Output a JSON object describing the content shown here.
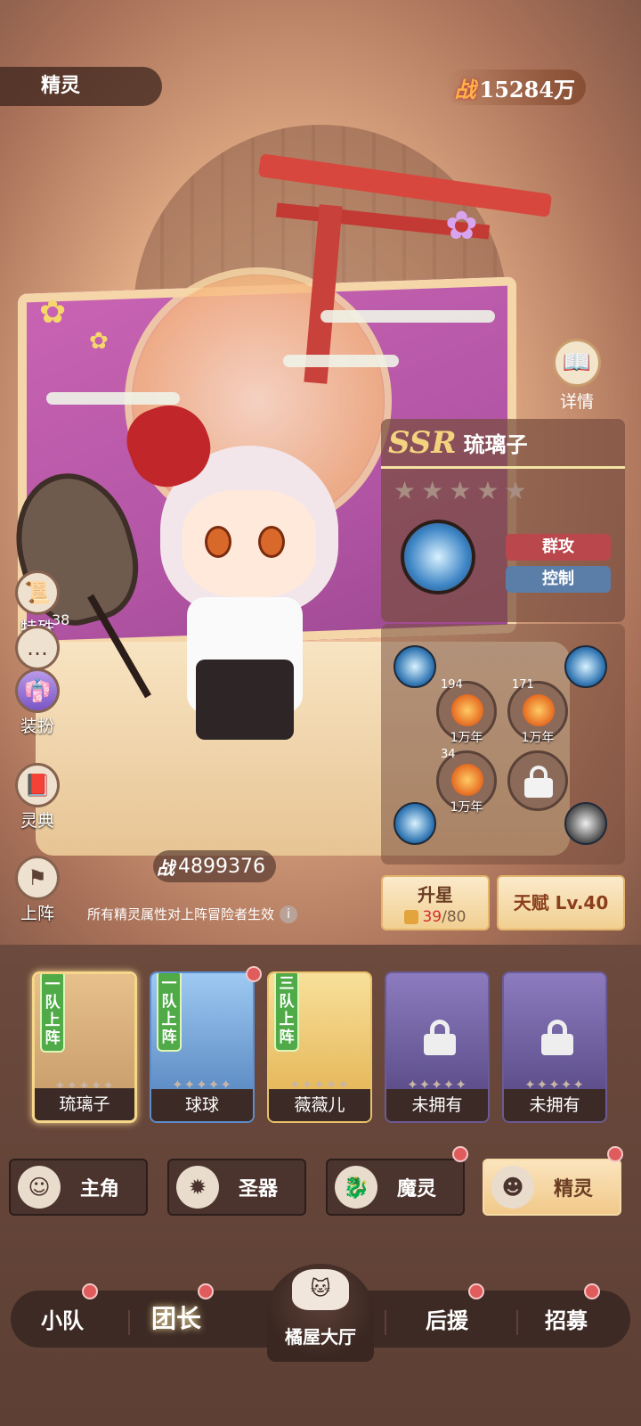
{
  "header": {
    "tab_label": "精灵",
    "power_label": "战",
    "power_value": "15284万"
  },
  "detail": {
    "label": "详情",
    "icon": "book-icon"
  },
  "spirit": {
    "rarity": "SSR",
    "name": "琉璃子",
    "stars": [
      "★",
      "★",
      "★",
      "★",
      "★"
    ],
    "tags": [
      "群攻",
      "控制"
    ],
    "power_label": "战",
    "power_value": "4899376"
  },
  "skill_slots": [
    {
      "count": "194",
      "years": "1万年"
    },
    {
      "count": "171",
      "years": "1万年"
    },
    {
      "count": "34",
      "years": "1万年"
    }
  ],
  "side_buttons": [
    {
      "label": "特殊",
      "icon": "scroll-icon"
    },
    {
      "label": "",
      "icon": "chat-bubble-icon"
    },
    {
      "label": "装扮",
      "icon": "outfit-icon"
    },
    {
      "label": "灵典",
      "icon": "codex-icon"
    },
    {
      "label": "上阵",
      "icon": "deploy-icon"
    }
  ],
  "side_badge": "38",
  "note": "所有精灵属性对上阵冒险者生效",
  "upgrade": {
    "label": "升星",
    "current": "39",
    "sep": "/",
    "max": "80"
  },
  "talent": {
    "label": "天赋 Lv.40"
  },
  "roster": [
    {
      "name": "琉璃子",
      "team": "一队上阵",
      "owned": true,
      "selected": true
    },
    {
      "name": "球球",
      "team": "一队上阵",
      "owned": true,
      "selected": false
    },
    {
      "name": "薇薇儿",
      "team": "三队上阵",
      "owned": true,
      "selected": false
    },
    {
      "name": "未拥有",
      "team": "",
      "owned": false,
      "selected": false
    },
    {
      "name": "未拥有",
      "team": "",
      "owned": false,
      "selected": false
    }
  ],
  "categories": [
    {
      "label": "主角",
      "active": false
    },
    {
      "label": "圣器",
      "active": false
    },
    {
      "label": "魔灵",
      "active": false
    },
    {
      "label": "精灵",
      "active": true
    }
  ],
  "nav": {
    "items": [
      "小队",
      "团长",
      "后援",
      "招募"
    ],
    "center": "橘屋大厅",
    "active": "团长"
  },
  "colors": {
    "accent": "#f1c98a",
    "tag_attack": "#b9474c",
    "tag_control": "#5b7ea8",
    "badge_red": "#e05c5c"
  }
}
